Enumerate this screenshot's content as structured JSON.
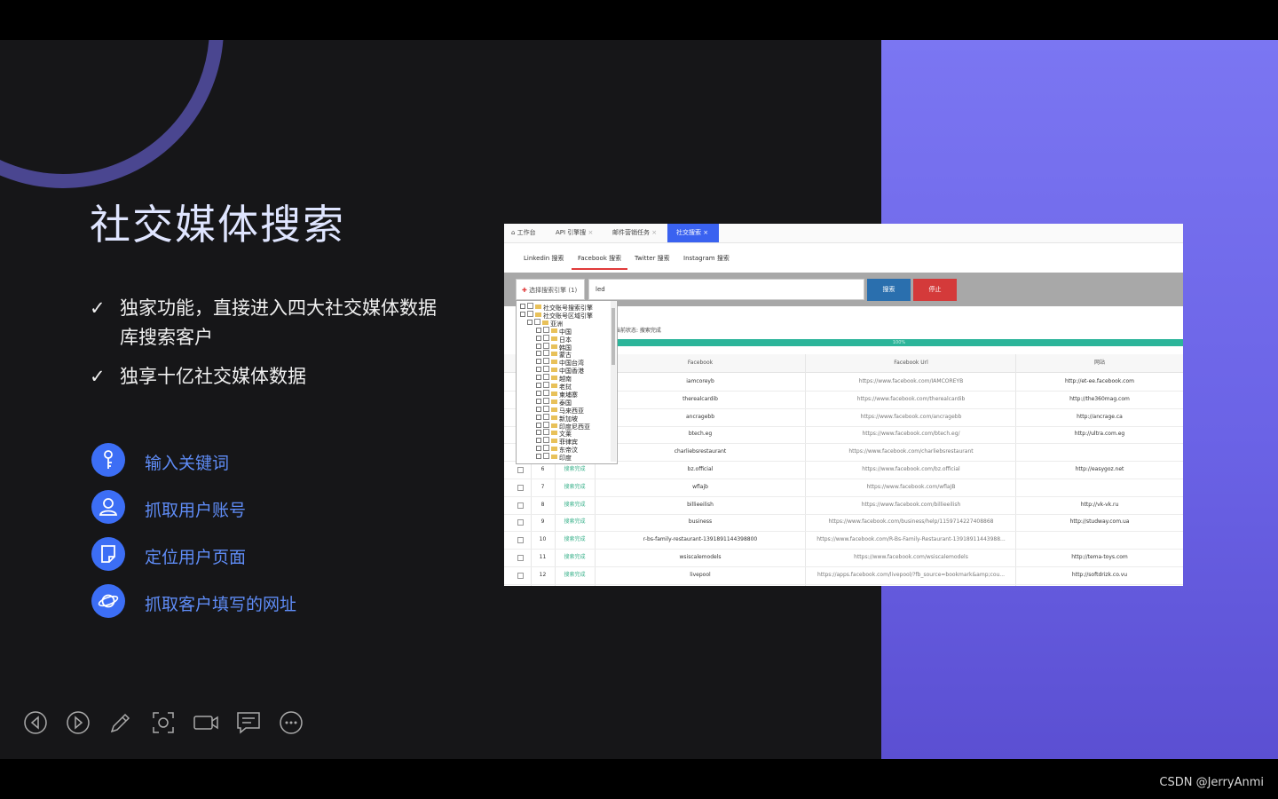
{
  "slide": {
    "title": "社交媒体搜索",
    "bullets": [
      {
        "check": "✓",
        "text": "独家功能，直接进入四大社交媒体数据库搜索客户"
      },
      {
        "check": "✓",
        "text": "独享十亿社交媒体数据"
      }
    ],
    "features": [
      {
        "icon": "key-icon",
        "label": "输入关键词"
      },
      {
        "icon": "user-icon",
        "label": "抓取用户账号"
      },
      {
        "icon": "page-icon",
        "label": "定位用户页面"
      },
      {
        "icon": "planet-icon",
        "label": "抓取客户填写的网址"
      }
    ],
    "controls": [
      "prev-icon",
      "next-icon",
      "pen-icon",
      "screenshot-icon",
      "camera-icon",
      "comment-icon",
      "more-icon"
    ],
    "accent": "#3c6ef5"
  },
  "app": {
    "tabs": [
      {
        "label": "⌂ 工作台",
        "close": ""
      },
      {
        "label": "API 引擎搜",
        "close": "×"
      },
      {
        "label": "邮件营销任务",
        "close": "×"
      },
      {
        "label": "社交搜索",
        "close": "×"
      }
    ],
    "subtabs": [
      "Linkedin 搜索",
      "Facebook 搜索",
      "Twitter 搜索",
      "Instagram 搜索"
    ],
    "select_engine_label": "选择搜索引擎 (1)",
    "keyword_value": "led",
    "search_label": "搜索",
    "stop_label": "停止",
    "status_text": "当前状态: 搜索完成",
    "progress_label": "100%",
    "progress": 1.0,
    "headers": [
      "Facebook",
      "Facebook Url",
      "网站"
    ],
    "tree": [
      "社交账号搜索引擎",
      "社交账号区域引擎",
      "亚洲",
      "中国",
      "日本",
      "韩国",
      "蒙古",
      "中国台湾",
      "中国香港",
      "越南",
      "老挝",
      "柬埔寨",
      "泰国",
      "马来西亚",
      "新加坡",
      "印度尼西亚",
      "文莱",
      "菲律宾",
      "东帝汶",
      "印度"
    ],
    "rows": [
      {
        "no": "",
        "status": "",
        "fb": "iamcoreyb",
        "url": "https://www.facebook.com/IAMCOREYB",
        "site": "http://et-ee.facebook.com"
      },
      {
        "no": "",
        "status": "",
        "fb": "therealcardib",
        "url": "https://www.facebook.com/therealcardib",
        "site": "http://the360mag.com"
      },
      {
        "no": "",
        "status": "",
        "fb": "ancragebb",
        "url": "https://www.facebook.com/ancragebb",
        "site": "http://ancrage.ca"
      },
      {
        "no": "",
        "status": "",
        "fb": "btech.eg",
        "url": "https://www.facebook.com/btech.eg/",
        "site": "http://ultra.com.eg"
      },
      {
        "no": "",
        "status": "",
        "fb": "charliebsrestaurant",
        "url": "https://www.facebook.com/charliebsrestaurant",
        "site": ""
      },
      {
        "no": "6",
        "status": "搜索完成",
        "fb": "bz.official",
        "url": "https://www.facebook.com/bz.official",
        "site": "http://easygoz.net"
      },
      {
        "no": "7",
        "status": "搜索完成",
        "fb": "wflajb",
        "url": "https://www.facebook.com/wflaJB",
        "site": ""
      },
      {
        "no": "8",
        "status": "搜索完成",
        "fb": "billieeilish",
        "url": "https://www.facebook.com/billieeilish",
        "site": "http://vk-vk.ru"
      },
      {
        "no": "9",
        "status": "搜索完成",
        "fb": "business",
        "url": "https://www.facebook.com/business/help/1159714227408868",
        "site": "http://studway.com.ua"
      },
      {
        "no": "10",
        "status": "搜索完成",
        "fb": "r-bs-family-restaurant-1391891144398800",
        "url": "https://www.facebook.com/R-Bs-Family-Restaurant-13918911443988...",
        "site": ""
      },
      {
        "no": "11",
        "status": "搜索完成",
        "fb": "wsiscalemodels",
        "url": "https://www.facebook.com/wsiscalemodels",
        "site": "http://tema-toys.com"
      },
      {
        "no": "12",
        "status": "搜索完成",
        "fb": "livepool",
        "url": "https://apps.facebook.com/livepool/?fb_source=bookmark&amp;cou...",
        "site": "http://softdrizk.co.vu"
      }
    ]
  },
  "watermark": "CSDN @JerryAnmi"
}
